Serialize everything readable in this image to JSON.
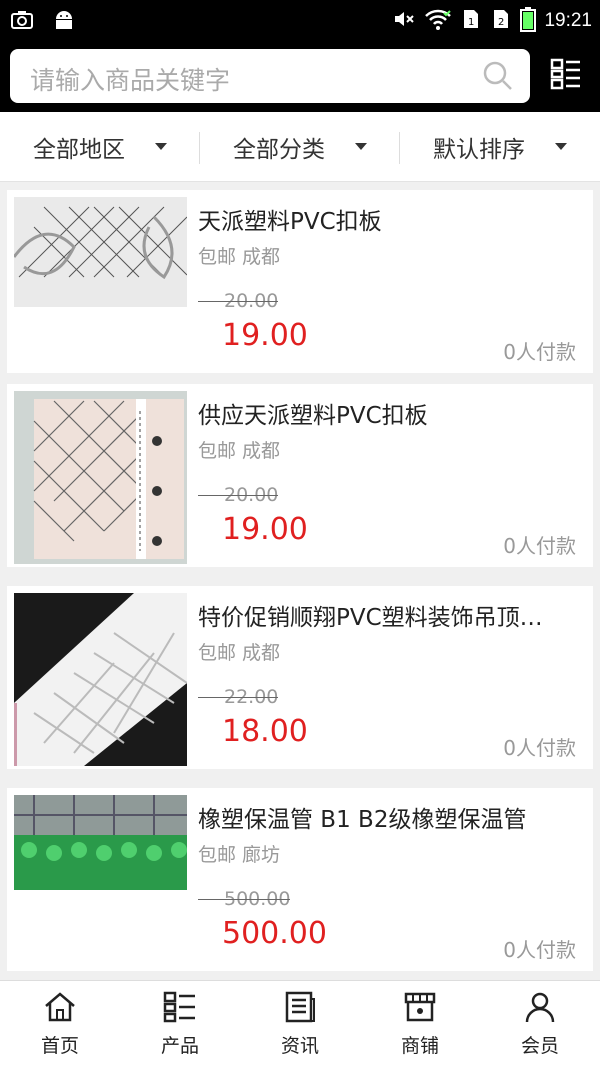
{
  "status_bar": {
    "time": "19:21",
    "icons": [
      "camera-icon",
      "android-icon",
      "mute-icon",
      "wifi-icon",
      "sim1-icon",
      "sim2-icon",
      "battery-icon"
    ]
  },
  "search": {
    "placeholder": "请输入商品关键字",
    "icon": "search-icon",
    "menu_icon": "grid-menu-icon"
  },
  "filters": [
    {
      "label": "全部地区"
    },
    {
      "label": "全部分类"
    },
    {
      "label": "默认排序"
    }
  ],
  "products": [
    {
      "title": "天派塑料PVC扣板",
      "shipping": "包邮",
      "city": "成都",
      "old_price": "20.00",
      "price": "19.00",
      "sold": "0人付款",
      "image": "pvc-panel-diamond-pattern"
    },
    {
      "title": "供应天派塑料PVC扣板",
      "shipping": "包邮",
      "city": "成都",
      "old_price": "20.00",
      "price": "19.00",
      "sold": "0人付款",
      "image": "pvc-panel-pink-lattice"
    },
    {
      "title": "特价促销顺翔PVC塑料装饰吊顶…",
      "shipping": "包邮",
      "city": "成都",
      "old_price": "22.00",
      "price": "18.00",
      "sold": "0人付款",
      "image": "pvc-panel-weave-pattern"
    },
    {
      "title": "橡塑保温管 B1 B2级橡塑保温管",
      "shipping": "包邮",
      "city": "廊坊",
      "old_price": "500.00",
      "price": "500.00",
      "sold": "0人付款",
      "image": "green-insulation-pipes-warehouse"
    }
  ],
  "bottom_nav": [
    {
      "label": "首页",
      "icon": "home-icon"
    },
    {
      "label": "产品",
      "icon": "product-grid-icon"
    },
    {
      "label": "资讯",
      "icon": "news-icon"
    },
    {
      "label": "商铺",
      "icon": "shop-icon"
    },
    {
      "label": "会员",
      "icon": "member-icon"
    }
  ],
  "colors": {
    "price": "#e02020",
    "header": "#000000",
    "muted": "#999999"
  }
}
